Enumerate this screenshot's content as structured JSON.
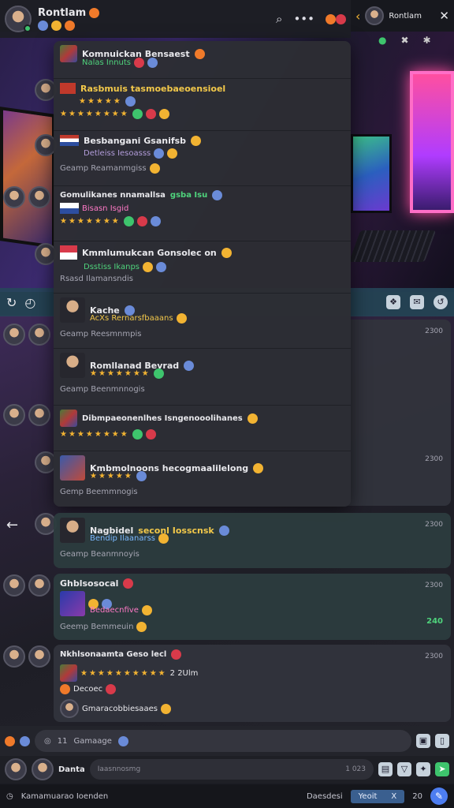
{
  "header": {
    "title": "Rontlam",
    "sub_icons": [
      "gift-icon",
      "smile-icon",
      "pin-icon"
    ],
    "icons": [
      "search-icon",
      "more-icon",
      "emoji-icon",
      "emoji-icon"
    ]
  },
  "side_panel": {
    "title": "Rontlam",
    "subicons": [
      "settings-icon",
      "close-icon",
      "info-icon"
    ]
  },
  "popup": {
    "items": [
      {
        "title": "Komnuickan Bensaest",
        "line1": "Nalas Innuts",
        "emojis": ""
      },
      {
        "title": "Rasbmuis tasmoebaeoensioel",
        "line1": "",
        "emojis": "★★★★★"
      },
      {
        "title": "",
        "line1": "",
        "emojis": "★★★★★★★★"
      },
      {
        "title": "Besbangani Gsanifsb",
        "line1": "Detleiss Iesoasss",
        "meta": "Geamp Reamanmgiss"
      },
      {
        "title": "Gomulikanes nnamallsa",
        "tag": "gsba Isu",
        "line1": "Bisasn Isgid",
        "emojis": "★★★★★★★"
      },
      {
        "title": "Kmmlumukcan Gonsolec on",
        "line1": "Dsstiss Ikanps",
        "meta": "Rsasd Ilamansndis"
      },
      {
        "title": "Kache",
        "line1": "AcXs Rernarsfbaaans",
        "meta": "Geamp Reesmnmpis"
      },
      {
        "title": "Romllanad Bevrad",
        "line1": "",
        "meta": "Geamp Beenmnnogis"
      },
      {
        "title": "Dibmpaeonenlhes Isngenooolihanes",
        "emojis": "★★★★★★★★"
      },
      {
        "title": "Kmbmolnoons hecogmaalilelong",
        "line1": "",
        "meta": "Gemp Beemmnogis"
      }
    ]
  },
  "strip": {
    "left_icons": [
      "sync-icon",
      "history-icon"
    ],
    "right_icons": [
      "shield-icon",
      "chat-icon",
      "refresh-icon"
    ]
  },
  "chat_rows": [
    {
      "name": "Nagbidel",
      "tag": "seconl Iosscnsk",
      "line1": "Bendip Ilaanarss",
      "meta": "Geamp Beanmnoyis",
      "time": "2300"
    },
    {
      "name": "Ghblsosocal",
      "line1": "Bedaecnfive",
      "meta": "Geemp Bemmeuin",
      "time": "2300",
      "green_time": "240"
    },
    {
      "name": "Nkhlsonaamta Geso lecl",
      "line1": "Decoec",
      "line2": "Gmaracobbiesaaes",
      "extra": "2 2Ulm",
      "time": "2300"
    }
  ],
  "right_times": [
    "2300",
    "2300",
    "2300"
  ],
  "composer": {
    "label": "Gamaage",
    "count": "11",
    "placeholder2": "Iaasnnosmg"
  },
  "composer_user": "Danta",
  "composer_count": "1 023",
  "statusbar": {
    "left": "Kamamuarao Ioenden",
    "right_label": "Daesdesi",
    "pill_a": "Yeoit",
    "pill_b": "X",
    "pill_c": "20"
  },
  "colors": {
    "accent": "#4d7df0",
    "online": "#3ec46d",
    "highlight": "#4fd37c"
  }
}
